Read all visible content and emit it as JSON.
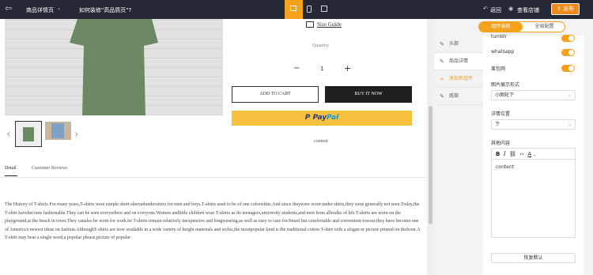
{
  "topbar": {
    "page_select": "商品详情页",
    "page_name": "如何装修\"高品质页\"?",
    "back": "返回",
    "view_store": "查看店铺",
    "publish": "发布"
  },
  "product": {
    "size_guide": "Size Guide",
    "quantity_label": "Quantity",
    "quantity": "1",
    "minus": "−",
    "plus": "+",
    "add_to_cart": "ADD TO CART",
    "buy_it_now": "BUY IT NOW",
    "paypal_pay": "Pay",
    "paypal_pal": "Pal",
    "content": "content",
    "tabs": [
      "Detail",
      "Customer Reviews"
    ],
    "description": "The History of T-shirts For many years,T-shirts were simple short-sleevedundershirts for men and boys.T-shirts used to be of one colorwhite.And since theywere worn under shirts,they were generally not seen.Today,the T-shirt havebecome fashionable.They can be seen everywhere and on everyone.Women andlittle children wear T-shirts as do teenagers,university students,and men from allwalks of life.T-shirts are worn on the playground,at the beach in town.They canalso be worn for work.be T-shirts remain relatively inexpensive and longwearing,as well as easy to care for.Smart but comfortable and convenient towear,they have become one of America's newest ideas on fashion.AlthoughT-shirts are now available in a wide variety of height materials and styles,the mostpopular kind is the traditional cotton T-shirt with a slogan or picture printed on thefront.A T-shirt may bear a single word,a popular phrase,picture of popular"
  },
  "panel": {
    "tabs": [
      "组件装修",
      "全局配置"
    ],
    "nav": [
      "头部",
      "商品详情",
      "添加新组件",
      "底部"
    ],
    "toggles": [
      "tumblr",
      "whatsapp",
      "蛮包网"
    ],
    "image_mode_label": "图片展示形式",
    "image_mode_value": "小图轮下",
    "detail_pos_label": "详情位置",
    "detail_pos_value": "下",
    "other_label": "其他内容",
    "editor_content": "content",
    "reset": "恢复默认"
  },
  "colors": {
    "accent": "#f4a11b",
    "topbar": "#232834",
    "publish": "#f08a1c",
    "paypal": "#f8c13d"
  }
}
